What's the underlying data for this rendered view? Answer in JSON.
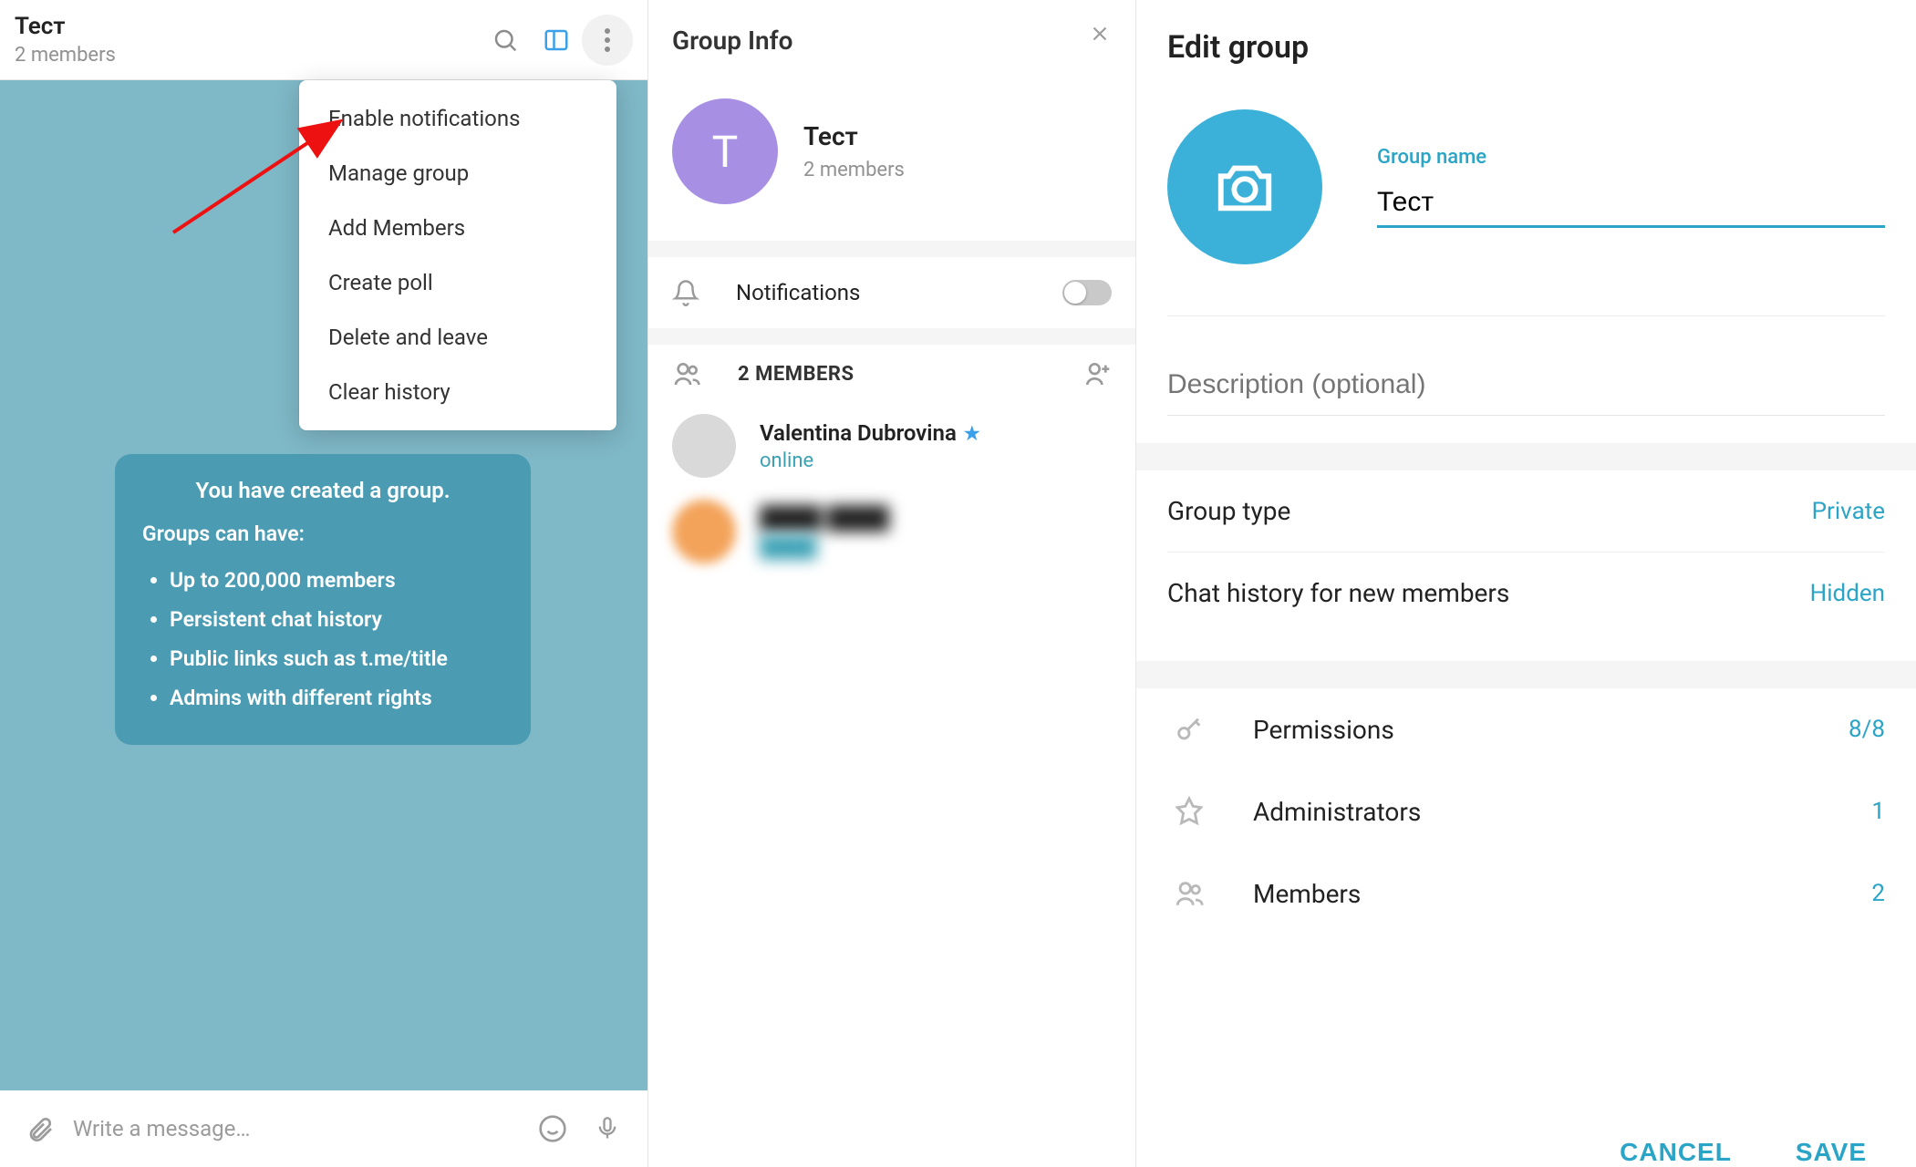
{
  "chat": {
    "title": "Тест",
    "subtitle": "2 members",
    "menu": [
      "Enable notifications",
      "Manage group",
      "Add Members",
      "Create poll",
      "Delete and leave",
      "Clear history"
    ],
    "msg": {
      "head": "You have created a group.",
      "sub": "Groups can have:",
      "items": [
        "Up to 200,000 members",
        "Persistent chat history",
        "Public links such as t.me/title",
        "Admins with different rights"
      ]
    },
    "composer_placeholder": "Write a message…"
  },
  "info": {
    "title": "Group Info",
    "group_name": "Тест",
    "group_sub": "2 members",
    "avatar_letter": "T",
    "notifications_label": "Notifications",
    "members_header": "2 MEMBERS",
    "members": [
      {
        "name": "Valentina Dubrovina",
        "status": "online",
        "starred": true
      },
      {
        "name": "████ ████",
        "status": "████",
        "starred": false
      }
    ]
  },
  "edit": {
    "title": "Edit group",
    "name_label": "Group name",
    "name_value": "Тест",
    "desc_placeholder": "Description (optional)",
    "rows": {
      "type_label": "Group type",
      "type_value": "Private",
      "history_label": "Chat history for new members",
      "history_value": "Hidden",
      "perm_label": "Permissions",
      "perm_value": "8/8",
      "admin_label": "Administrators",
      "admin_value": "1",
      "members_label": "Members",
      "members_value": "2"
    },
    "cancel": "CANCEL",
    "save": "SAVE"
  }
}
